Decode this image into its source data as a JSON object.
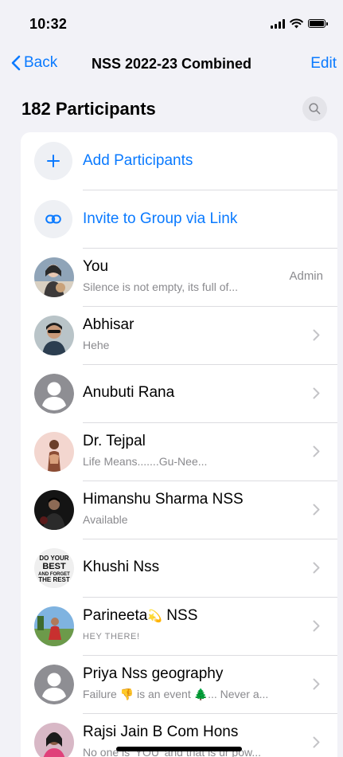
{
  "status_bar": {
    "time": "10:32"
  },
  "nav": {
    "back_label": "Back",
    "title": "NSS 2022-23 Combined",
    "edit_label": "Edit"
  },
  "header": {
    "participant_count": "182 Participants"
  },
  "actions": {
    "add": {
      "label": "Add Participants",
      "icon": "plus-icon"
    },
    "invite": {
      "label": "Invite to Group via Link",
      "icon": "link-icon"
    }
  },
  "members": [
    {
      "name": "You",
      "status": "Silence is not empty, its full of...",
      "badge": "Admin"
    },
    {
      "name": "Abhisar",
      "status": "Hehe"
    },
    {
      "name": "Anubuti Rana",
      "status": ""
    },
    {
      "name": "Dr. Tejpal",
      "status": "Life Means.......Gu-Nee..."
    },
    {
      "name": "Himanshu Sharma NSS",
      "status": "Available"
    },
    {
      "name": "Khushi Nss",
      "status": ""
    },
    {
      "name_a": "Parineeta",
      "name_emoji": "💫",
      "name_b": " NSS",
      "status": "HEY THERE!"
    },
    {
      "name": "Priya Nss geography",
      "status_a": "Failure ",
      "status_emoji1": "👎",
      "status_b": " is an event ",
      "status_emoji2": "🌲",
      "status_c": "... Never a..."
    },
    {
      "name": "Rajsi Jain B Com Hons",
      "status": "No one is 'YOU' and that is ur pow..."
    }
  ],
  "avatar_texts": {
    "khushi": [
      "DO YOUR",
      "BEST",
      "AND FORGET",
      "THE REST"
    ]
  },
  "colors": {
    "accent": "#0a7aff",
    "background": "#f2f2f7",
    "secondary_text": "#8a8a8e"
  }
}
